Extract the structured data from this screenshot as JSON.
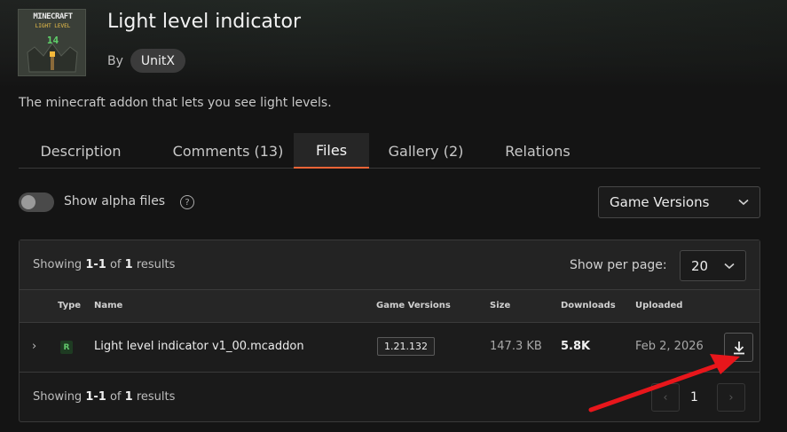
{
  "project": {
    "title": "Light level indicator",
    "by_label": "By",
    "author": "UnitX",
    "description": "The minecraft addon that lets you see light levels.",
    "logo": {
      "title": "MINECRAFT",
      "subtitle": "LIGHT LEVEL",
      "number": "14"
    }
  },
  "tabs": [
    {
      "label": "Description",
      "active": false
    },
    {
      "label": "Comments (13)",
      "active": false
    },
    {
      "label": "Files",
      "active": true
    },
    {
      "label": "Gallery (2)",
      "active": false
    },
    {
      "label": "Relations",
      "active": false
    }
  ],
  "filters": {
    "alpha_label": "Show alpha files",
    "alpha_enabled": false,
    "help_glyph": "?",
    "game_versions_label": "Game Versions"
  },
  "results": {
    "showing_label": "Showing",
    "range": "1-1",
    "of_label": "of",
    "total": "1",
    "results_label": "results",
    "per_page_label": "Show per page:",
    "per_page_value": "20"
  },
  "table": {
    "headers": {
      "type": "Type",
      "name": "Name",
      "game_versions": "Game Versions",
      "size": "Size",
      "downloads": "Downloads",
      "uploaded": "Uploaded"
    },
    "rows": [
      {
        "type": "R",
        "name": "Light level indicator v1_00.mcaddon",
        "game_version": "1.21.132",
        "size": "147.3 KB",
        "downloads": "5.8K",
        "uploaded": "Feb 2, 2026"
      }
    ]
  },
  "pagination": {
    "current": "1",
    "prev_glyph": "‹",
    "next_glyph": "›",
    "expand_glyph": "›"
  },
  "colors": {
    "accent": "#f16436",
    "release": "#62c86c",
    "annotation_arrow": "#e8161b"
  }
}
